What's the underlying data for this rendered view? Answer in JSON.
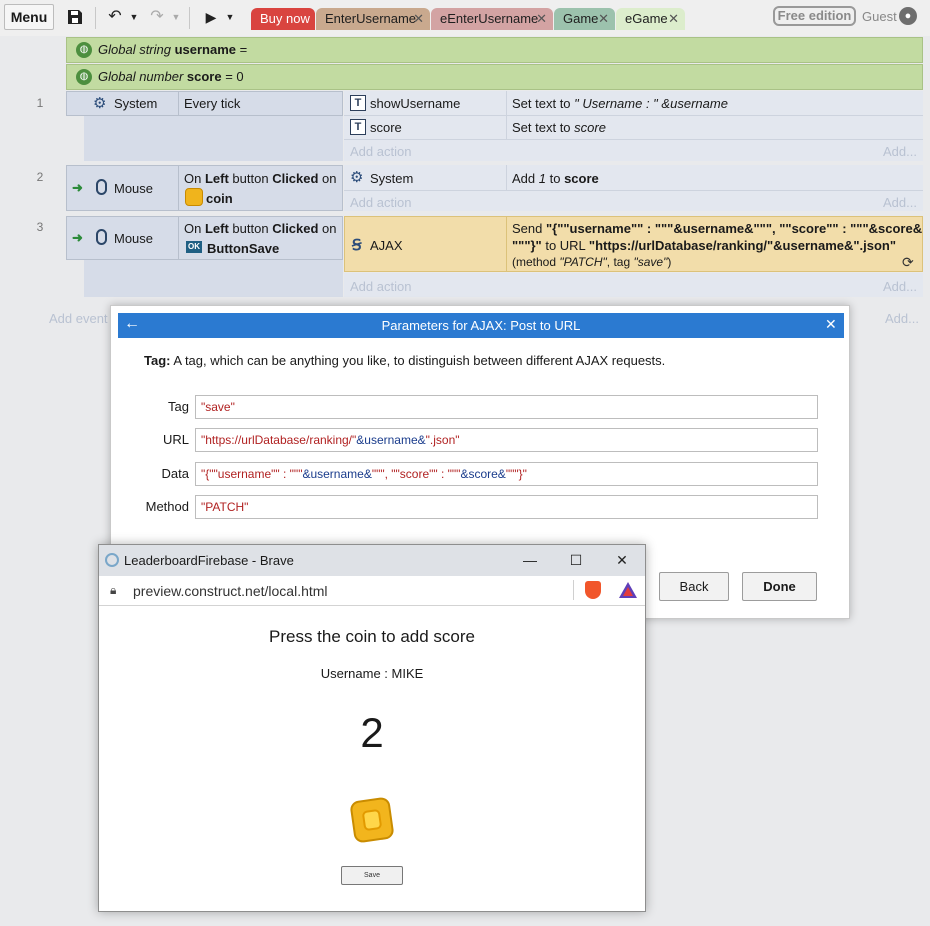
{
  "toolbar": {
    "menu_label": "Menu",
    "tabs": [
      {
        "label": "Buy now",
        "color": "#d9443f"
      },
      {
        "label": "EnterUsername",
        "color": "#c9a98e"
      },
      {
        "label": "eEnterUsername",
        "color": "#d3a3a3"
      },
      {
        "label": "Game",
        "color": "#9cc2ad"
      },
      {
        "label": "eGame",
        "color": "#dcedcc"
      }
    ],
    "tab_close": "✕",
    "free_edition": "Free edition",
    "guest": "Guest"
  },
  "sheet": {
    "globals": [
      {
        "prefix": "Global string ",
        "name": "username",
        "suffix": " ="
      },
      {
        "prefix": "Global number ",
        "name": "score",
        "suffix": " = 0"
      }
    ],
    "events": [
      {
        "number": "1",
        "object": "System",
        "condition": "Every tick",
        "actions": [
          {
            "object": "showUsername",
            "text_pre": "Set text to ",
            "text_str": "\" Username : \"",
            "text_op": " &",
            "text_var": "username"
          },
          {
            "object": "score",
            "text_pre": "Set text to ",
            "text_var": "score"
          }
        ]
      },
      {
        "number": "2",
        "object": "Mouse",
        "cond_parts": [
          "On ",
          "Left",
          " button ",
          "Clicked",
          " on"
        ],
        "cond_target": "coin",
        "action_object": "System",
        "action_pre": "Add ",
        "action_num": "1",
        "action_mid": " to ",
        "action_var": "score"
      },
      {
        "number": "3",
        "object": "Mouse",
        "cond_parts": [
          "On ",
          "Left",
          " button ",
          "Clicked",
          " on"
        ],
        "cond_target": "ButtonSave",
        "ok_icon": "OK",
        "action_object": "AJAX",
        "action_line1_pre": "Send ",
        "action_line1_bold": "\"{\"\"username\"\" : \"\"\"&username&\"\"\", \"\"score\"\" : \"\"\"&score&",
        "action_line2_bold1": "\"\"\"}\"",
        "action_line2_mid": " to URL ",
        "action_line2_bold2": "\"https://urlDatabase/ranking/\"&username&\".json\"",
        "action_line3_a": "(method ",
        "action_line3_method": "\"PATCH\"",
        "action_line3_b": ", tag ",
        "action_line3_tag": "\"save\"",
        "action_line3_c": ")"
      }
    ],
    "add_action": "Add action",
    "add_dots": "Add...",
    "add_event": "Add event"
  },
  "dialog": {
    "title": "Parameters for AJAX: Post to URL",
    "desc_bold": "Tag:",
    "desc": " A tag, which can be anything you like, to distinguish between different AJAX requests.",
    "fields": [
      {
        "label": "Tag",
        "value": "\"save\""
      },
      {
        "label": "URL",
        "value_str1": "\"https://urlDatabase/ranking/\"",
        "value_var": "&username&",
        "value_str2": "\".json\""
      },
      {
        "label": "Data",
        "value_str1": "\"{\"\"username\"\" : \"\"\"",
        "value_var1": "&username&",
        "value_str2": "\"\"\", \"\"score\"\" : \"\"\"",
        "value_var2": "&score&",
        "value_str3": "\"\"\"}\""
      },
      {
        "label": "Method",
        "value": "\"PATCH\""
      }
    ],
    "back": "Back",
    "done": "Done"
  },
  "browser": {
    "title": "LeaderboardFirebase - Brave",
    "url": "preview.construct.net/local.html",
    "heading": "Press the coin to add score",
    "username_text": "Username : MIKE",
    "score": "2",
    "save": "Save"
  }
}
